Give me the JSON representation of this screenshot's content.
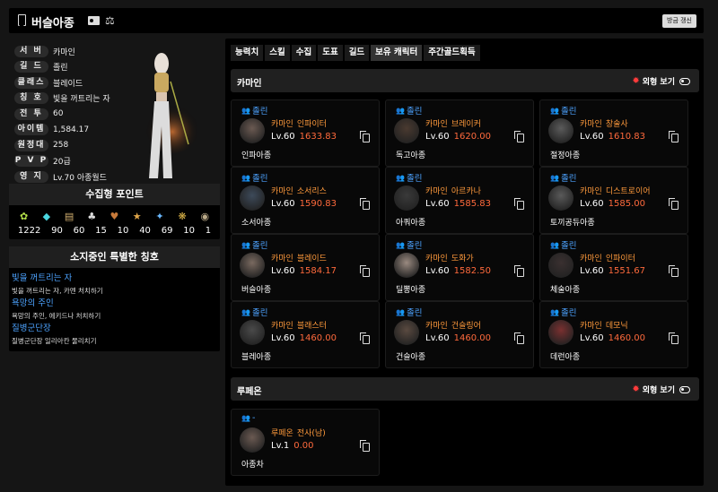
{
  "header": {
    "name": "버슬아종",
    "refresh_label": "방금 갱신"
  },
  "profile": {
    "rows": [
      {
        "label": "서 버",
        "value": "카마인"
      },
      {
        "label": "길 드",
        "value": "졸린"
      },
      {
        "label": "클래스",
        "value": "블레이드"
      },
      {
        "label": "칭 호",
        "value": "빛을 꺼트리는 자"
      },
      {
        "label": "전 투",
        "value": "60"
      },
      {
        "label": "아이템",
        "value": "1,584.17"
      },
      {
        "label": "원정대",
        "value": "258"
      },
      {
        "label": "P V P",
        "value": "20급"
      },
      {
        "label": "영 지",
        "value": "Lv.70 아종월드"
      }
    ]
  },
  "collection": {
    "title": "수집형 포인트",
    "items": [
      {
        "icon": "seed-icon",
        "value": "1222",
        "color": "#b4e04a"
      },
      {
        "icon": "island-heart-icon",
        "value": "90",
        "color": "#4ad6e0"
      },
      {
        "icon": "art-icon",
        "value": "60",
        "color": "#d2b070"
      },
      {
        "icon": "mokoko-icon",
        "value": "15",
        "color": "#dddddd"
      },
      {
        "icon": "giant-heart-icon",
        "value": "10",
        "color": "#c77a3a"
      },
      {
        "icon": "orpheus-star-icon",
        "value": "40",
        "color": "#e0a64a"
      },
      {
        "icon": "ignea-icon",
        "value": "69",
        "color": "#6ab8ff"
      },
      {
        "icon": "world-tree-leaf-icon",
        "value": "10",
        "color": "#e0b84a"
      },
      {
        "icon": "voyage-icon",
        "value": "1",
        "color": "#bbaa88"
      }
    ]
  },
  "special_titles": {
    "title": "소지중인 특별한 칭호",
    "items": [
      {
        "name": "빛을 꺼트리는 자",
        "desc": "빛을 꺼트리는 자, 카멘 처치하기"
      },
      {
        "name": "욕망의 주인",
        "desc": "욕망의 주인, 에키드나 처치하기"
      },
      {
        "name": "질병군단장",
        "desc": "질병군단장 일리아칸 물리치기"
      }
    ]
  },
  "tabs": [
    "능력치",
    "스킬",
    "수집",
    "도표",
    "길드",
    "보유 캐릭터",
    "주간골드획득"
  ],
  "active_tab": 5,
  "servers": [
    {
      "name": "카마인",
      "look_label": "외형 보기",
      "characters": [
        {
          "guild": "졸린",
          "server": "카마인",
          "class": "인파이터",
          "level": "Lv.60",
          "ilvl": "1633.83",
          "name": "인파아종"
        },
        {
          "guild": "졸린",
          "server": "카마인",
          "class": "브레이커",
          "level": "Lv.60",
          "ilvl": "1620.00",
          "name": "독고아종"
        },
        {
          "guild": "졸린",
          "server": "카마인",
          "class": "창술사",
          "level": "Lv.60",
          "ilvl": "1610.83",
          "name": "절정아종"
        },
        {
          "guild": "졸린",
          "server": "카마인",
          "class": "소서리스",
          "level": "Lv.60",
          "ilvl": "1590.83",
          "name": "소서아종"
        },
        {
          "guild": "졸린",
          "server": "카마인",
          "class": "아르카나",
          "level": "Lv.60",
          "ilvl": "1585.83",
          "name": "아쿼아종"
        },
        {
          "guild": "졸린",
          "server": "카마인",
          "class": "디스트로이어",
          "level": "Lv.60",
          "ilvl": "1585.00",
          "name": "토끼공듀아종"
        },
        {
          "guild": "졸린",
          "server": "카마인",
          "class": "블레이드",
          "level": "Lv.60",
          "ilvl": "1584.17",
          "name": "버슬아종"
        },
        {
          "guild": "졸린",
          "server": "카마인",
          "class": "도화가",
          "level": "Lv.60",
          "ilvl": "1582.50",
          "name": "딜뽕아종"
        },
        {
          "guild": "졸린",
          "server": "카마인",
          "class": "인파이터",
          "level": "Lv.60",
          "ilvl": "1551.67",
          "name": "체술아종"
        },
        {
          "guild": "졸린",
          "server": "카마인",
          "class": "블래스터",
          "level": "Lv.60",
          "ilvl": "1460.00",
          "name": "블레아종"
        },
        {
          "guild": "졸린",
          "server": "카마인",
          "class": "건슬링어",
          "level": "Lv.60",
          "ilvl": "1460.00",
          "name": "건슬아종"
        },
        {
          "guild": "졸린",
          "server": "카마인",
          "class": "데모닉",
          "level": "Lv.60",
          "ilvl": "1460.00",
          "name": "데런아종"
        }
      ]
    },
    {
      "name": "루페온",
      "look_label": "외형 보기",
      "characters": [
        {
          "guild": "-",
          "server": "루페온",
          "class": "전사(남)",
          "level": "Lv.1",
          "ilvl": "0.00",
          "name": "아종차"
        }
      ]
    }
  ]
}
